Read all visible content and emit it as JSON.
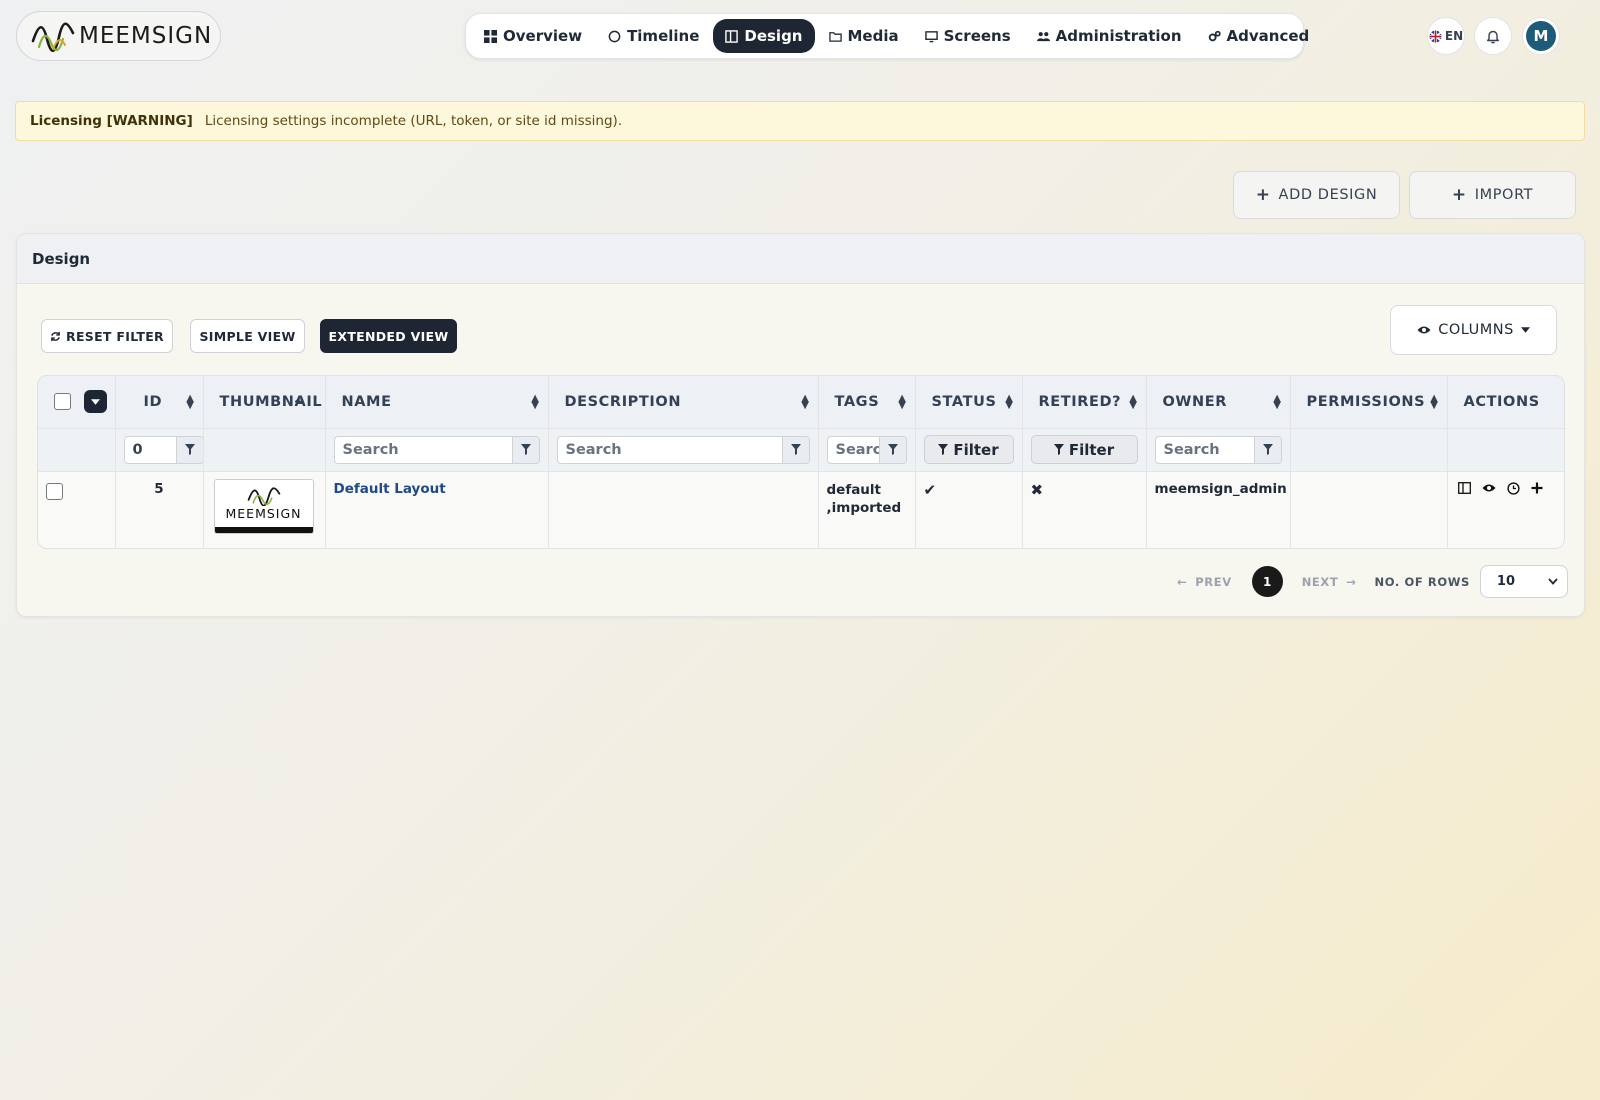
{
  "brand": {
    "logo_text": "MEEMSIGN"
  },
  "nav": {
    "items": [
      {
        "label": "Overview",
        "icon": "grid-icon"
      },
      {
        "label": "Timeline",
        "icon": "circle-icon"
      },
      {
        "label": "Design",
        "icon": "layout-icon",
        "active": true
      },
      {
        "label": "Media",
        "icon": "folder-icon"
      },
      {
        "label": "Screens",
        "icon": "monitor-icon"
      },
      {
        "label": "Administration",
        "icon": "users-icon"
      },
      {
        "label": "Advanced",
        "icon": "gears-icon"
      }
    ]
  },
  "header": {
    "language": "EN",
    "avatar_initial": "M"
  },
  "warning": {
    "title": "Licensing [WARNING]",
    "message": "Licensing settings incomplete (URL, token, or site id missing)."
  },
  "toolbar": {
    "add_design": "ADD DESIGN",
    "import": "IMPORT"
  },
  "card": {
    "title": "Design",
    "reset_filter": "RESET FILTER",
    "simple_view": "SIMPLE VIEW",
    "extended_view": "EXTENDED VIEW",
    "columns": "COLUMNS"
  },
  "table": {
    "headers": {
      "id": "ID",
      "thumbnail": "THUMBNAIL",
      "name": "NAME",
      "description": "DESCRIPTION",
      "tags": "TAGS",
      "status": "STATUS",
      "retired": "RETIRED?",
      "owner": "OWNER",
      "permissions": "PERMISSIONS",
      "actions": "ACTIONS"
    },
    "filters": {
      "id_value": "0",
      "search_placeholder": "Search",
      "filter_label": "Filter"
    },
    "rows": [
      {
        "id": "5",
        "thumbnail_text": "MEEMSIGN",
        "name": "Default Layout",
        "description": "",
        "tags": "default ,imported",
        "status": "✔",
        "retired": "✖",
        "owner": "meemsign_admin",
        "permissions": ""
      }
    ]
  },
  "pagination": {
    "prev": "PREV",
    "next": "NEXT",
    "current_page": "1",
    "rows_label": "NO. OF ROWS",
    "rows_value": "10"
  },
  "colors": {
    "accent_dark": "#1e2533",
    "link": "#1e4a8a",
    "warning_bg": "#fdf7dc",
    "avatar": "#1d5b7a"
  }
}
